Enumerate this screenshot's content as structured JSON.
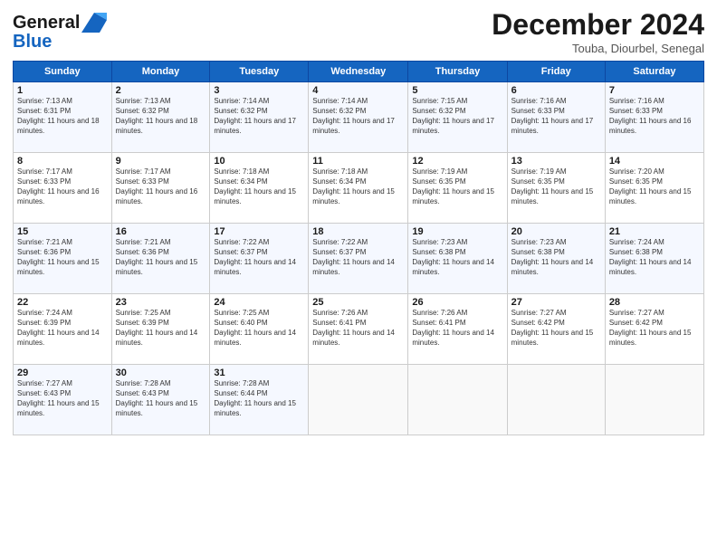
{
  "logo": {
    "general": "General",
    "blue": "Blue"
  },
  "header": {
    "month": "December 2024",
    "location": "Touba, Diourbel, Senegal"
  },
  "weekdays": [
    "Sunday",
    "Monday",
    "Tuesday",
    "Wednesday",
    "Thursday",
    "Friday",
    "Saturday"
  ],
  "weeks": [
    [
      {
        "day": "1",
        "sunrise": "Sunrise: 7:13 AM",
        "sunset": "Sunset: 6:31 PM",
        "daylight": "Daylight: 11 hours and 18 minutes."
      },
      {
        "day": "2",
        "sunrise": "Sunrise: 7:13 AM",
        "sunset": "Sunset: 6:32 PM",
        "daylight": "Daylight: 11 hours and 18 minutes."
      },
      {
        "day": "3",
        "sunrise": "Sunrise: 7:14 AM",
        "sunset": "Sunset: 6:32 PM",
        "daylight": "Daylight: 11 hours and 17 minutes."
      },
      {
        "day": "4",
        "sunrise": "Sunrise: 7:14 AM",
        "sunset": "Sunset: 6:32 PM",
        "daylight": "Daylight: 11 hours and 17 minutes."
      },
      {
        "day": "5",
        "sunrise": "Sunrise: 7:15 AM",
        "sunset": "Sunset: 6:32 PM",
        "daylight": "Daylight: 11 hours and 17 minutes."
      },
      {
        "day": "6",
        "sunrise": "Sunrise: 7:16 AM",
        "sunset": "Sunset: 6:33 PM",
        "daylight": "Daylight: 11 hours and 17 minutes."
      },
      {
        "day": "7",
        "sunrise": "Sunrise: 7:16 AM",
        "sunset": "Sunset: 6:33 PM",
        "daylight": "Daylight: 11 hours and 16 minutes."
      }
    ],
    [
      {
        "day": "8",
        "sunrise": "Sunrise: 7:17 AM",
        "sunset": "Sunset: 6:33 PM",
        "daylight": "Daylight: 11 hours and 16 minutes."
      },
      {
        "day": "9",
        "sunrise": "Sunrise: 7:17 AM",
        "sunset": "Sunset: 6:33 PM",
        "daylight": "Daylight: 11 hours and 16 minutes."
      },
      {
        "day": "10",
        "sunrise": "Sunrise: 7:18 AM",
        "sunset": "Sunset: 6:34 PM",
        "daylight": "Daylight: 11 hours and 15 minutes."
      },
      {
        "day": "11",
        "sunrise": "Sunrise: 7:18 AM",
        "sunset": "Sunset: 6:34 PM",
        "daylight": "Daylight: 11 hours and 15 minutes."
      },
      {
        "day": "12",
        "sunrise": "Sunrise: 7:19 AM",
        "sunset": "Sunset: 6:35 PM",
        "daylight": "Daylight: 11 hours and 15 minutes."
      },
      {
        "day": "13",
        "sunrise": "Sunrise: 7:19 AM",
        "sunset": "Sunset: 6:35 PM",
        "daylight": "Daylight: 11 hours and 15 minutes."
      },
      {
        "day": "14",
        "sunrise": "Sunrise: 7:20 AM",
        "sunset": "Sunset: 6:35 PM",
        "daylight": "Daylight: 11 hours and 15 minutes."
      }
    ],
    [
      {
        "day": "15",
        "sunrise": "Sunrise: 7:21 AM",
        "sunset": "Sunset: 6:36 PM",
        "daylight": "Daylight: 11 hours and 15 minutes."
      },
      {
        "day": "16",
        "sunrise": "Sunrise: 7:21 AM",
        "sunset": "Sunset: 6:36 PM",
        "daylight": "Daylight: 11 hours and 15 minutes."
      },
      {
        "day": "17",
        "sunrise": "Sunrise: 7:22 AM",
        "sunset": "Sunset: 6:37 PM",
        "daylight": "Daylight: 11 hours and 14 minutes."
      },
      {
        "day": "18",
        "sunrise": "Sunrise: 7:22 AM",
        "sunset": "Sunset: 6:37 PM",
        "daylight": "Daylight: 11 hours and 14 minutes."
      },
      {
        "day": "19",
        "sunrise": "Sunrise: 7:23 AM",
        "sunset": "Sunset: 6:38 PM",
        "daylight": "Daylight: 11 hours and 14 minutes."
      },
      {
        "day": "20",
        "sunrise": "Sunrise: 7:23 AM",
        "sunset": "Sunset: 6:38 PM",
        "daylight": "Daylight: 11 hours and 14 minutes."
      },
      {
        "day": "21",
        "sunrise": "Sunrise: 7:24 AM",
        "sunset": "Sunset: 6:38 PM",
        "daylight": "Daylight: 11 hours and 14 minutes."
      }
    ],
    [
      {
        "day": "22",
        "sunrise": "Sunrise: 7:24 AM",
        "sunset": "Sunset: 6:39 PM",
        "daylight": "Daylight: 11 hours and 14 minutes."
      },
      {
        "day": "23",
        "sunrise": "Sunrise: 7:25 AM",
        "sunset": "Sunset: 6:39 PM",
        "daylight": "Daylight: 11 hours and 14 minutes."
      },
      {
        "day": "24",
        "sunrise": "Sunrise: 7:25 AM",
        "sunset": "Sunset: 6:40 PM",
        "daylight": "Daylight: 11 hours and 14 minutes."
      },
      {
        "day": "25",
        "sunrise": "Sunrise: 7:26 AM",
        "sunset": "Sunset: 6:41 PM",
        "daylight": "Daylight: 11 hours and 14 minutes."
      },
      {
        "day": "26",
        "sunrise": "Sunrise: 7:26 AM",
        "sunset": "Sunset: 6:41 PM",
        "daylight": "Daylight: 11 hours and 14 minutes."
      },
      {
        "day": "27",
        "sunrise": "Sunrise: 7:27 AM",
        "sunset": "Sunset: 6:42 PM",
        "daylight": "Daylight: 11 hours and 15 minutes."
      },
      {
        "day": "28",
        "sunrise": "Sunrise: 7:27 AM",
        "sunset": "Sunset: 6:42 PM",
        "daylight": "Daylight: 11 hours and 15 minutes."
      }
    ],
    [
      {
        "day": "29",
        "sunrise": "Sunrise: 7:27 AM",
        "sunset": "Sunset: 6:43 PM",
        "daylight": "Daylight: 11 hours and 15 minutes."
      },
      {
        "day": "30",
        "sunrise": "Sunrise: 7:28 AM",
        "sunset": "Sunset: 6:43 PM",
        "daylight": "Daylight: 11 hours and 15 minutes."
      },
      {
        "day": "31",
        "sunrise": "Sunrise: 7:28 AM",
        "sunset": "Sunset: 6:44 PM",
        "daylight": "Daylight: 11 hours and 15 minutes."
      },
      null,
      null,
      null,
      null
    ]
  ]
}
